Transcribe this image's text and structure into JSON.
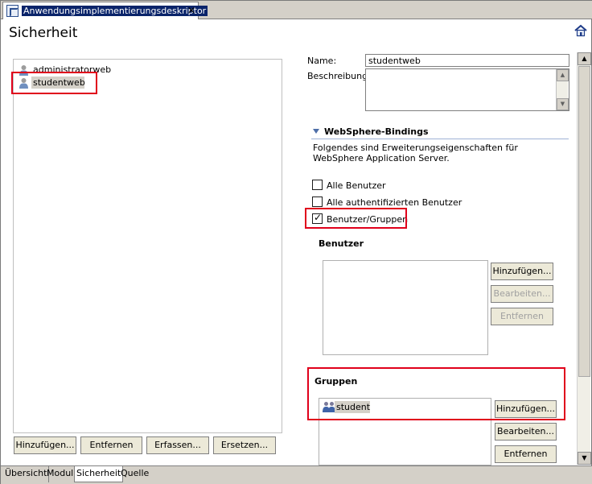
{
  "editor_tab": {
    "title": "Anwendungsimplementierungsdeskriptor",
    "close": "✕"
  },
  "page_title": "Sicherheit",
  "help_icon": "help-house-icon",
  "tree": {
    "items": [
      {
        "label": "administratorweb",
        "icon": "user-role-icon"
      },
      {
        "label": "studentweb",
        "icon": "user-role-icon",
        "selected": true
      }
    ]
  },
  "left_buttons": {
    "add": "Hinzufügen...",
    "remove": "Entfernen",
    "capture": "Erfassen...",
    "replace": "Ersetzen..."
  },
  "form": {
    "name_label": "Name:",
    "name_value": "studentweb",
    "description_label": "Beschreibung:",
    "description_value": ""
  },
  "bindings": {
    "title": "WebSphere-Bindings",
    "description": "Folgendes sind Erweiterungseigenschaften für WebSphere Application Server.",
    "options": [
      {
        "label": "Alle Benutzer",
        "checked": false
      },
      {
        "label": "Alle authentifizierten Benutzer",
        "checked": false
      },
      {
        "label": "Benutzer/Gruppen",
        "checked": true
      }
    ]
  },
  "users": {
    "title": "Benutzer",
    "add": "Hinzufügen...",
    "edit": "Bearbeiten...",
    "remove": "Entfernen"
  },
  "groups": {
    "title": "Gruppen",
    "items": [
      {
        "label": "student",
        "icon": "group-icon"
      }
    ],
    "add": "Hinzufügen...",
    "edit": "Bearbeiten...",
    "remove": "Entfernen"
  },
  "bottom_tabs": [
    "Übersicht",
    "Modul",
    "Sicherheit",
    "Quelle"
  ],
  "active_bottom_tab": "Sicherheit",
  "colors": {
    "highlight_box": "#e0001b",
    "selection": "#0a246a"
  }
}
